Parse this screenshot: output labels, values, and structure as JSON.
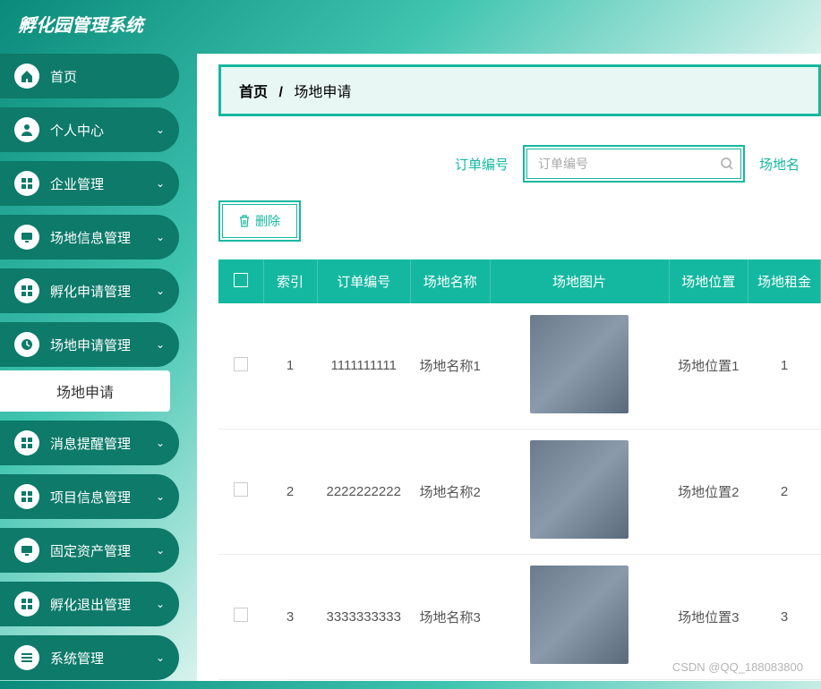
{
  "app_title": "孵化园管理系统",
  "breadcrumb": {
    "home": "首页",
    "current": "场地申请"
  },
  "sidebar": {
    "items": [
      {
        "label": "首页",
        "icon": "home"
      },
      {
        "label": "个人中心",
        "icon": "user",
        "expandable": true
      },
      {
        "label": "企业管理",
        "icon": "grid",
        "expandable": true
      },
      {
        "label": "场地信息管理",
        "icon": "monitor",
        "expandable": true
      },
      {
        "label": "孵化申请管理",
        "icon": "grid",
        "expandable": true
      },
      {
        "label": "场地申请管理",
        "icon": "clock",
        "expandable": true,
        "sub": "场地申请",
        "active": true
      },
      {
        "label": "消息提醒管理",
        "icon": "grid",
        "expandable": true
      },
      {
        "label": "项目信息管理",
        "icon": "grid",
        "expandable": true
      },
      {
        "label": "固定资产管理",
        "icon": "monitor",
        "expandable": true
      },
      {
        "label": "孵化退出管理",
        "icon": "grid",
        "expandable": true
      },
      {
        "label": "系统管理",
        "icon": "list",
        "expandable": true
      }
    ]
  },
  "filter": {
    "label1": "订单编号",
    "placeholder1": "订单编号",
    "label2": "场地名"
  },
  "toolbar": {
    "delete_label": "删除"
  },
  "table": {
    "headers": [
      "",
      "索引",
      "订单编号",
      "场地名称",
      "场地图片",
      "场地位置",
      "场地租金"
    ],
    "rows": [
      {
        "index": "1",
        "order_no": "1111111111",
        "name": "场地名称1",
        "location": "场地位置1",
        "rent": "1"
      },
      {
        "index": "2",
        "order_no": "2222222222",
        "name": "场地名称2",
        "location": "场地位置2",
        "rent": "2"
      },
      {
        "index": "3",
        "order_no": "3333333333",
        "name": "场地名称3",
        "location": "场地位置3",
        "rent": "3"
      }
    ]
  },
  "watermark": "CSDN @QQ_188083800"
}
